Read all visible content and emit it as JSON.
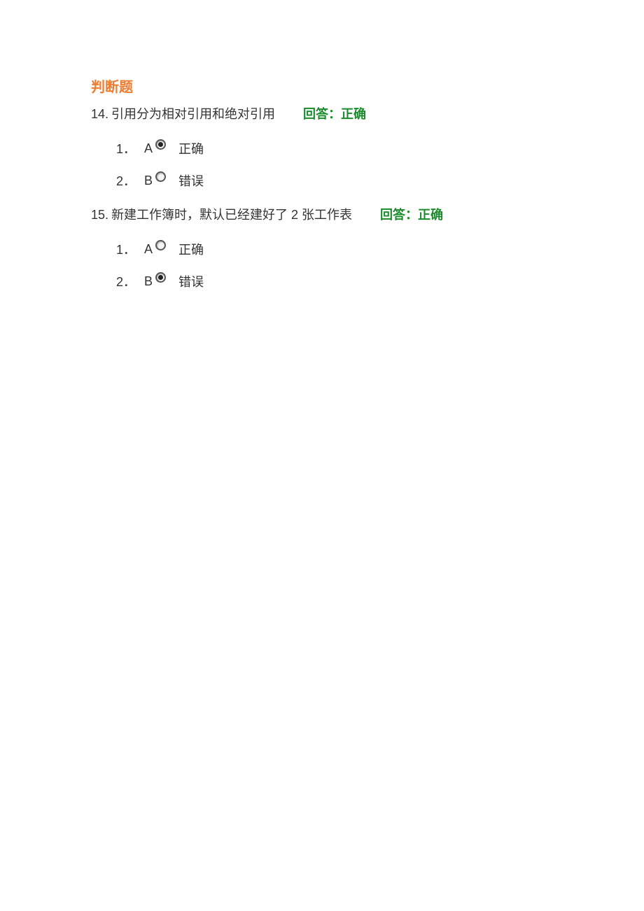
{
  "section_title": "判断题",
  "questions": [
    {
      "number": "14.",
      "text": "引用分为相对引用和绝对引用",
      "answer": "回答：正确",
      "options": [
        {
          "index": "1．",
          "letter": "A",
          "checked": true,
          "label": "正确"
        },
        {
          "index": "2．",
          "letter": "B",
          "checked": false,
          "label": "错误"
        }
      ]
    },
    {
      "number": "15.",
      "text": "新建工作簿时，默认已经建好了 2 张工作表",
      "answer": "回答：正确",
      "options": [
        {
          "index": "1．",
          "letter": "A",
          "checked": false,
          "label": "正确"
        },
        {
          "index": "2．",
          "letter": "B",
          "checked": true,
          "label": "错误"
        }
      ]
    }
  ]
}
